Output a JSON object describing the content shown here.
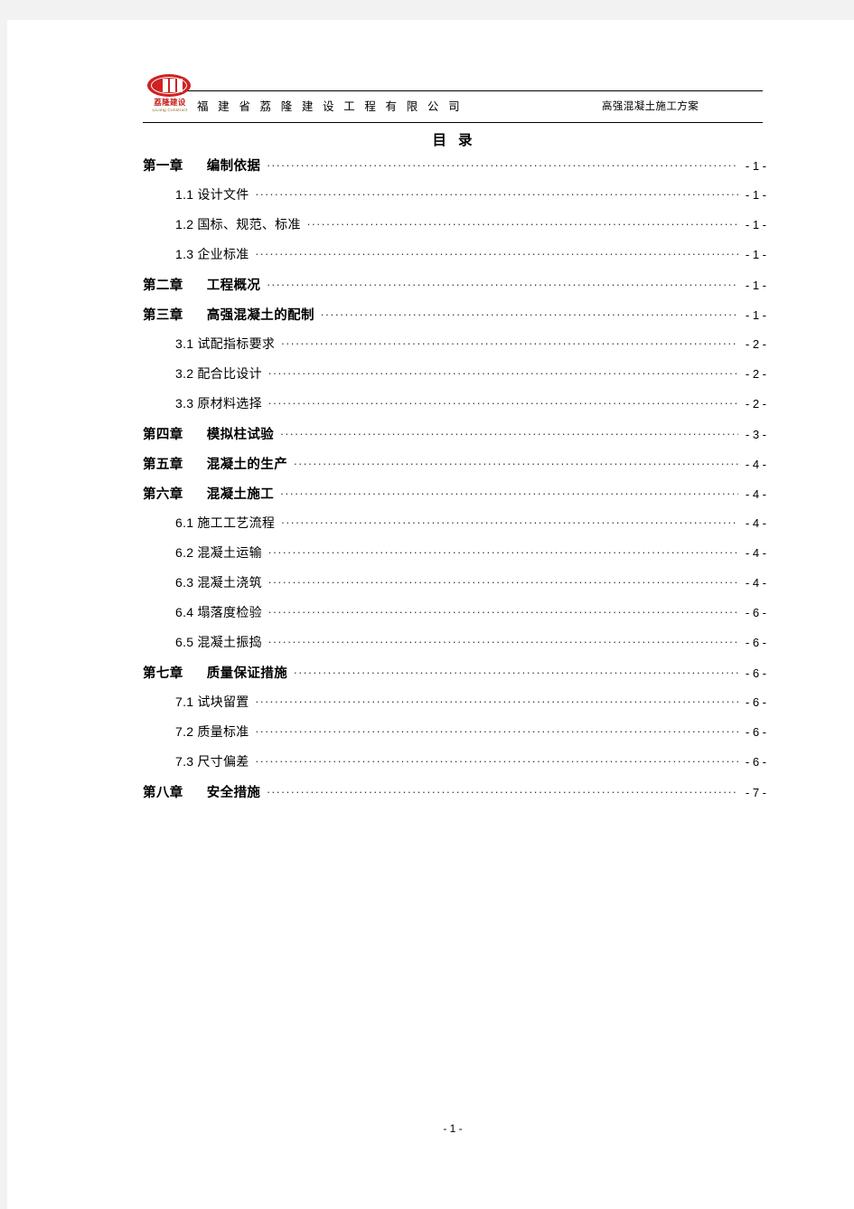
{
  "header": {
    "company_name": "福 建 省 荔 隆 建 设 工 程 有 限 公 司",
    "document_title": "高强混凝土施工方案",
    "logo": {
      "name": "lilong-construction-logo",
      "chinese_text": "荔隆建设",
      "english_text": "LiLong Construct",
      "color": "#c4201b"
    }
  },
  "toc": {
    "title_left": "目",
    "title_right": "录",
    "entries": [
      {
        "level": 1,
        "label": "第一章",
        "gap": true,
        "text": "编制依据",
        "page": "- 1 -"
      },
      {
        "level": 2,
        "number": "1.1",
        "text": "设计文件",
        "page": "- 1 -"
      },
      {
        "level": 2,
        "number": "1.2",
        "text": "国标、规范、标准",
        "page": "- 1 -"
      },
      {
        "level": 2,
        "number": "1.3",
        "text": "企业标准",
        "page": "- 1 -"
      },
      {
        "level": 1,
        "label": "第二章",
        "gap": true,
        "text": "工程概况",
        "page": "- 1 -"
      },
      {
        "level": 1,
        "label": "第三章",
        "gap": true,
        "text": "高强混凝土的配制",
        "page": "- 1 -"
      },
      {
        "level": 2,
        "number": "3.1",
        "text": "试配指标要求",
        "page": "- 2 -"
      },
      {
        "level": 2,
        "number": "3.2",
        "text": "配合比设计",
        "page": "- 2 -"
      },
      {
        "level": 2,
        "number": "3.3",
        "text": "原材料选择",
        "page": "- 2 -"
      },
      {
        "level": 1,
        "label": "第四章",
        "gap": true,
        "text": "模拟柱试验",
        "page": "- 3 -"
      },
      {
        "level": 1,
        "label": "第五章",
        "gap": true,
        "text": "混凝土的生产",
        "page": "- 4 -"
      },
      {
        "level": 1,
        "label": "第六章",
        "gap": true,
        "text": "混凝土施工",
        "page": "- 4 -"
      },
      {
        "level": 2,
        "number": "6.1",
        "text": "施工工艺流程",
        "page": "- 4 -"
      },
      {
        "level": 2,
        "number": "6.2",
        "text": "混凝土运输",
        "page": "- 4 -"
      },
      {
        "level": 2,
        "number": "6.3",
        "text": "混凝土浇筑",
        "page": "- 4 -"
      },
      {
        "level": 2,
        "number": "6.4",
        "text": "塌落度检验",
        "page": "- 6 -"
      },
      {
        "level": 2,
        "number": "6.5",
        "text": "混凝土振捣",
        "page": "- 6 -"
      },
      {
        "level": 1,
        "label": "第七章",
        "gap": true,
        "text": "质量保证措施",
        "page": "- 6 -"
      },
      {
        "level": 2,
        "number": "7.1",
        "text": "试块留置",
        "page": "- 6 -"
      },
      {
        "level": 2,
        "number": "7.2",
        "text": "质量标准",
        "page": "- 6 -"
      },
      {
        "level": 2,
        "number": "7.3",
        "text": "尺寸偏差",
        "page": "- 6 -"
      },
      {
        "level": 1,
        "label": "第八章",
        "gap": true,
        "text": "安全措施",
        "page": "- 7 -"
      }
    ]
  },
  "footer": {
    "page_number": "- 1 -"
  }
}
